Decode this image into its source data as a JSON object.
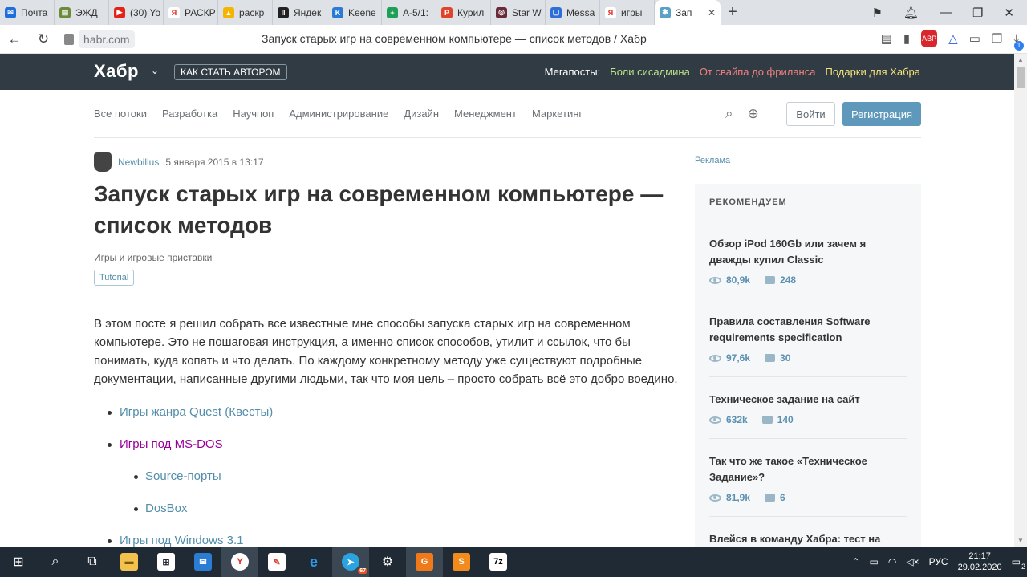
{
  "browser": {
    "tabs": [
      {
        "label": "Почта",
        "color": "#1e6fd9",
        "glyph": "✉"
      },
      {
        "label": "ЭЖД",
        "color": "#6a8c3a",
        "glyph": "▤"
      },
      {
        "label": "(30) Yo",
        "color": "#e62117",
        "glyph": "▶"
      },
      {
        "label": "РАСКР",
        "color": "#ffffff",
        "glyph": "Я"
      },
      {
        "label": "раскр",
        "color": "#f5b400",
        "glyph": "▲"
      },
      {
        "label": "Яндек",
        "color": "#222222",
        "glyph": "II"
      },
      {
        "label": "Keene",
        "color": "#2a7bd5",
        "glyph": "K"
      },
      {
        "label": "А-5/1:",
        "color": "#1e9e56",
        "glyph": "+"
      },
      {
        "label": "Курил",
        "color": "#e2412b",
        "glyph": "P"
      },
      {
        "label": "Star W",
        "color": "#6b2a3a",
        "glyph": "◎"
      },
      {
        "label": "Messa",
        "color": "#2d6fd6",
        "glyph": "▢"
      },
      {
        "label": "игры",
        "color": "#ffffff",
        "glyph": "Я"
      }
    ],
    "active_tab": {
      "label": "Зап",
      "close": "✕"
    },
    "new_tab": "+",
    "url_domain": "habr.com",
    "page_title": "Запуск старых игр на современном компьютере — список методов / Хабр",
    "ext_badge": "ABP",
    "download_count": "1"
  },
  "habr": {
    "logo": "Хабр",
    "become_author": "КАК СТАТЬ АВТОРОМ",
    "megaposts_label": "Мегапосты:",
    "megaposts": [
      {
        "label": "Боли сисадмина",
        "color": "#b9e38a"
      },
      {
        "label": "От свайпа до фриланса",
        "color": "#f08080"
      },
      {
        "label": "Подарки для Хабра",
        "color": "#f4e27a"
      }
    ],
    "hubs": [
      "Все потоки",
      "Разработка",
      "Научпоп",
      "Администрирование",
      "Дизайн",
      "Менеджмент",
      "Маркетинг"
    ],
    "login": "Войти",
    "register": "Регистрация"
  },
  "article": {
    "author": "Newbilius",
    "date": "5 января 2015 в 13:17",
    "title": "Запуск старых игр на современном компьютере — список методов",
    "hub": "Игры и игровые приставки",
    "badge": "Tutorial",
    "lead": "В этом посте я решил собрать все известные мне способы запуска старых игр на современном компьютере. Это не пошаговая инструкция, а именно список способов, утилит и ссылок, что бы понимать, куда копать и что делать. По каждому конкретному методу уже существуют подробные документации, написанные другими людьми, так что моя цель – просто собрать всё это добро воедино.",
    "toc": [
      {
        "label": "Игры жанра Quest (Квесты)",
        "level": 1,
        "visited": false
      },
      {
        "label": "Игры под MS-DOS",
        "level": 1,
        "visited": true
      },
      {
        "label": "Source-порты",
        "level": 2,
        "visited": false
      },
      {
        "label": "DosBox",
        "level": 2,
        "visited": false
      },
      {
        "label": "Игры под Windows 3.1",
        "level": 1,
        "visited": false
      }
    ]
  },
  "sidebar": {
    "ad_label": "Реклама",
    "heading": "РЕКОМЕНДУЕМ",
    "items": [
      {
        "title": "Обзор iPod 160Gb или зачем я дважды купил Classic",
        "views": "80,9k",
        "comments": "248"
      },
      {
        "title": "Правила составления Software requirements specification",
        "views": "97,6k",
        "comments": "30"
      },
      {
        "title": "Техническое задание на сайт",
        "views": "632k",
        "comments": "140"
      },
      {
        "title": "Так что же такое «Техническое Задание»?",
        "views": "81,9k",
        "comments": "6"
      },
      {
        "title": "Влейся в команду Хабра: тест на находчивость и интуицию",
        "views": "",
        "comments": ""
      }
    ]
  },
  "taskbar": {
    "lang": "РУС",
    "time": "21:17",
    "date": "29.02.2020",
    "notifications": "2",
    "telegram_badge": "67"
  }
}
